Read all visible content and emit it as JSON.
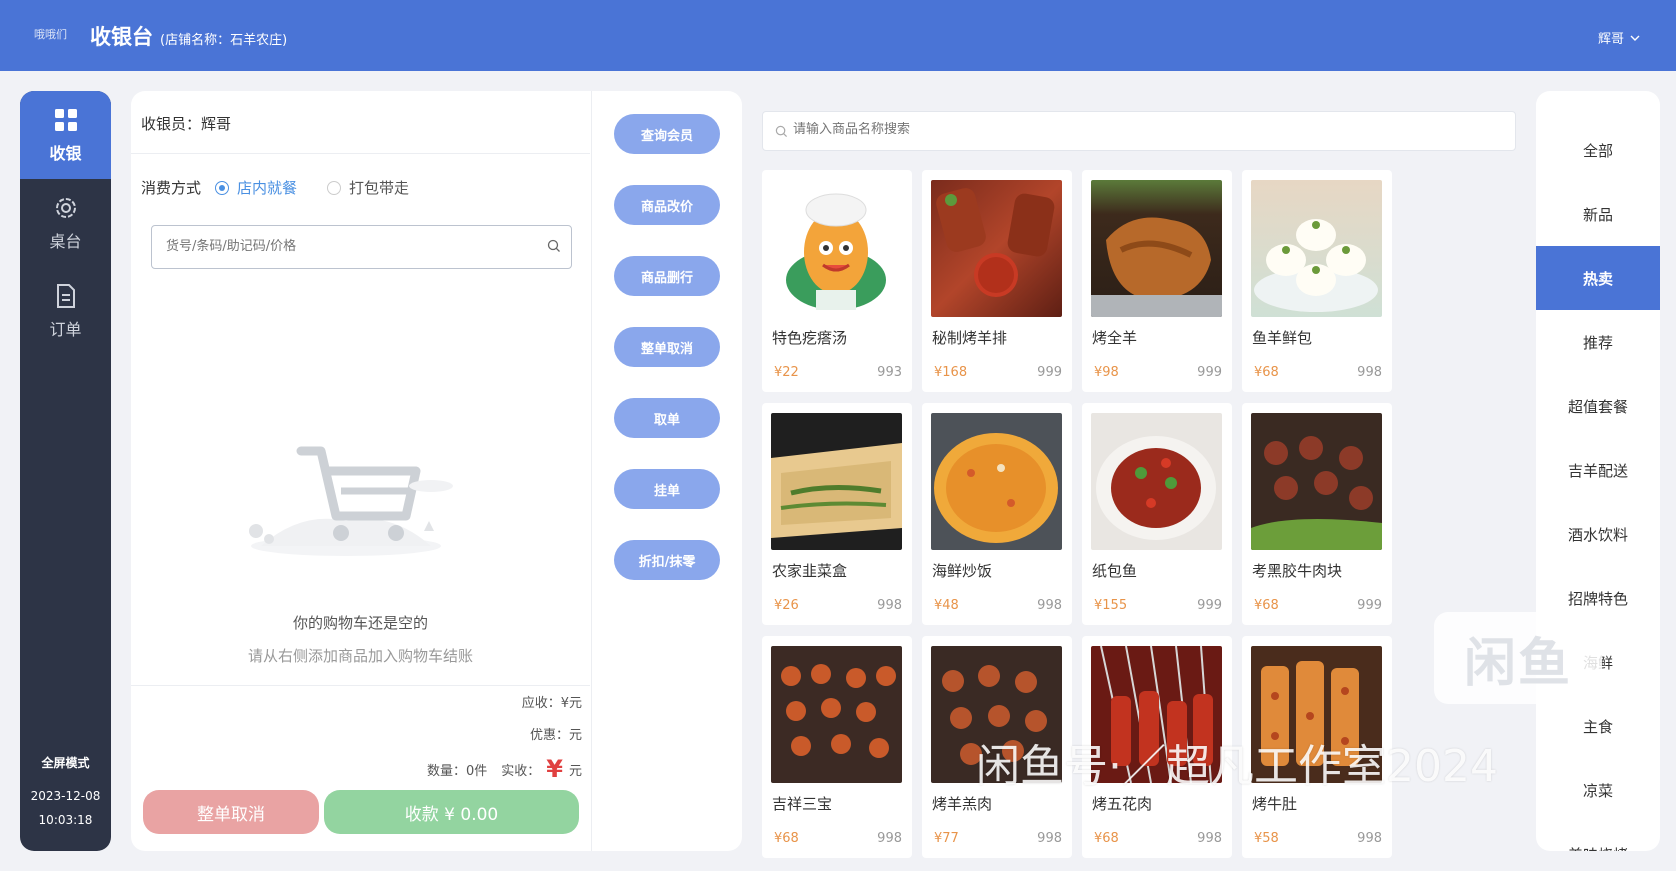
{
  "header": {
    "logo": "哦哦们",
    "title": "收银台",
    "store": "(店铺名称：石羊农庄)",
    "user": "辉哥"
  },
  "nav": {
    "items": [
      {
        "label": "收银",
        "icon": "grid-icon"
      },
      {
        "label": "桌台",
        "icon": "gear-icon"
      },
      {
        "label": "订单",
        "icon": "document-icon"
      }
    ],
    "fullscreen": "全屏模式",
    "date": "2023-12-08",
    "time": "10:03:18"
  },
  "cart": {
    "cashier": "收银员：辉哥",
    "mode_label": "消费方式",
    "modes": [
      "店内就餐",
      "打包带走"
    ],
    "selected_mode": "店内就餐",
    "search_placeholder": "货号/条码/助记码/价格",
    "empty_title": "你的购物车还是空的",
    "empty_sub": "请从右侧添加商品加入购物车结账",
    "receivable": "应收：¥元",
    "discount": "优惠：元",
    "count_label": "数量：0件",
    "paid_label": "实收：",
    "paid_yen": "¥",
    "paid_unit": "元",
    "cancel_all": "整单取消",
    "pay": "收款 ¥ 0.00"
  },
  "actions": [
    "查询会员",
    "商品改价",
    "商品删行",
    "整单取消",
    "取单",
    "挂单",
    "折扣/抹零"
  ],
  "product_search_placeholder": "请输入商品名称搜索",
  "products": [
    {
      "name": "特色疙瘩汤",
      "price": "¥22",
      "stock": "993"
    },
    {
      "name": "秘制烤羊排",
      "price": "¥168",
      "stock": "999"
    },
    {
      "name": "烤全羊",
      "price": "¥98",
      "stock": "999"
    },
    {
      "name": "鱼羊鲜包",
      "price": "¥68",
      "stock": "998"
    },
    {
      "name": "农家韭菜盒",
      "price": "¥26",
      "stock": "998"
    },
    {
      "name": "海鲜炒饭",
      "price": "¥48",
      "stock": "998"
    },
    {
      "name": "纸包鱼",
      "price": "¥155",
      "stock": "999"
    },
    {
      "name": "考黑胶牛肉块",
      "price": "¥68",
      "stock": "999"
    },
    {
      "name": "吉祥三宝",
      "price": "¥68",
      "stock": "998"
    },
    {
      "name": "烤羊羔肉",
      "price": "¥77",
      "stock": "998"
    },
    {
      "name": "烤五花肉",
      "price": "¥68",
      "stock": "998"
    },
    {
      "name": "烤牛肚",
      "price": "¥58",
      "stock": "998"
    }
  ],
  "categories": [
    "全部",
    "新品",
    "热卖",
    "推荐",
    "超值套餐",
    "吉羊配送",
    "酒水饮料",
    "招牌特色",
    "海鲜",
    "主食",
    "凉菜",
    "美味烧烤"
  ],
  "active_category": "热卖",
  "watermark": {
    "logo": "闲鱼",
    "text": "闲鱼号·／超凡工作室2024"
  }
}
